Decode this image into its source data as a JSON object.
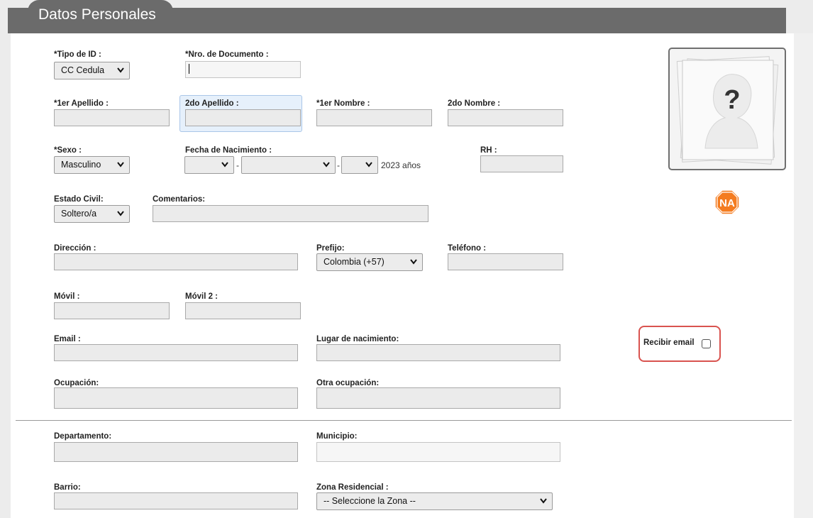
{
  "section": {
    "title": "Datos Personales"
  },
  "fields": {
    "tipo_id": {
      "label": "*Tipo de ID :",
      "value": "CC Cedula"
    },
    "nro_documento": {
      "label": "*Nro. de Documento :",
      "value": ""
    },
    "primer_apellido": {
      "label": "*1er Apellido :",
      "value": ""
    },
    "segundo_apellido": {
      "label": "2do Apellido :",
      "value": ""
    },
    "primer_nombre": {
      "label": "*1er Nombre :",
      "value": ""
    },
    "segundo_nombre": {
      "label": "2do Nombre :",
      "value": ""
    },
    "sexo": {
      "label": "*Sexo :",
      "value": "Masculino"
    },
    "fecha_nacimiento": {
      "label": "Fecha de Nacimiento :",
      "day": "",
      "month": "",
      "year": "",
      "separator": "-",
      "age_text": "2023 años"
    },
    "rh": {
      "label": "RH :",
      "value": ""
    },
    "estado_civil": {
      "label": "Estado Civil:",
      "value": "Soltero/a"
    },
    "comentarios": {
      "label": "Comentarios:",
      "value": ""
    },
    "direccion": {
      "label": "Dirección :",
      "value": ""
    },
    "prefijo": {
      "label": "Prefijo:",
      "value": "Colombia (+57)"
    },
    "telefono": {
      "label": "Teléfono :",
      "value": ""
    },
    "movil": {
      "label": "Móvil :",
      "value": ""
    },
    "movil2": {
      "label": "Móvil 2 :",
      "value": ""
    },
    "email": {
      "label": "Email :",
      "value": ""
    },
    "lugar_nacimiento": {
      "label": "Lugar de nacimiento:",
      "value": ""
    },
    "recibir_email": {
      "label": "Recibir email",
      "checked": false
    },
    "ocupacion": {
      "label": "Ocupación:",
      "value": ""
    },
    "otra_ocupacion": {
      "label": "Otra ocupación:",
      "value": ""
    },
    "departamento": {
      "label": "Departamento:",
      "value": ""
    },
    "municipio": {
      "label": "Municipio:",
      "value": ""
    },
    "barrio": {
      "label": "Barrio:",
      "value": ""
    },
    "zona_residencial": {
      "label": "Zona Residencial :",
      "value": "-- Seleccione la Zona --"
    }
  },
  "photo": {
    "icon": "unknown-person-icon",
    "glyph": "?"
  },
  "badge": {
    "text": "NA",
    "color": "#f47c20"
  },
  "colors": {
    "header": "#6b6b6b",
    "highlight": "#d9534f",
    "focus": "#e6f0fb"
  }
}
